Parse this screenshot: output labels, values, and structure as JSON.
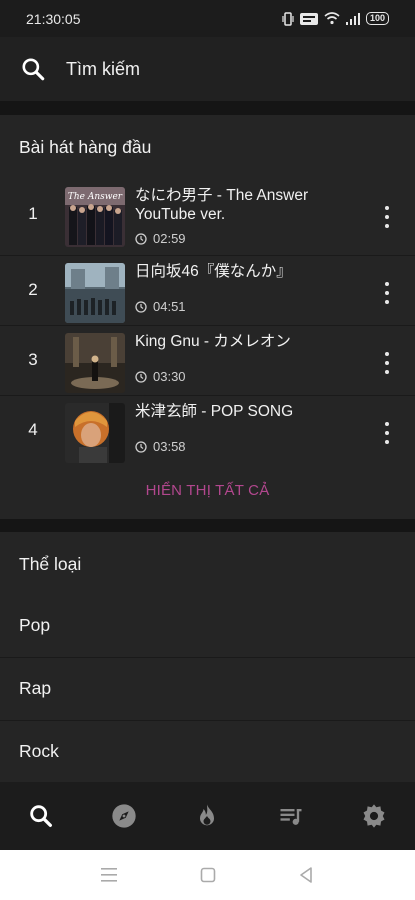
{
  "status_bar": {
    "time": "21:30:05",
    "battery": "100"
  },
  "search": {
    "label": "Tìm kiếm",
    "icon": "search-icon"
  },
  "top_songs": {
    "title": "Bài hát hàng đầu",
    "show_all_label": "HIỂN THỊ TẤT CẢ",
    "songs": [
      {
        "rank": "1",
        "title": "なにわ男子 - The Answer YouTube ver.",
        "duration": "02:59"
      },
      {
        "rank": "2",
        "title": "日向坂46『僕なんか』",
        "duration": "04:51"
      },
      {
        "rank": "3",
        "title": "King Gnu - カメレオン",
        "duration": "03:30"
      },
      {
        "rank": "4",
        "title": "米津玄師 - POP SONG",
        "duration": "03:58"
      }
    ]
  },
  "genres": {
    "title": "Thể loại",
    "items": [
      "Pop",
      "Rap",
      "Rock"
    ]
  },
  "bottom_nav": {
    "items": [
      "search-icon",
      "compass-icon",
      "fire-icon",
      "playlist-icon",
      "settings-icon"
    ],
    "active_color": "#ffffff",
    "inactive_color": "#8a8a8a"
  },
  "colors": {
    "accent": "#b2478e",
    "background": "#151515",
    "card": "#252525"
  }
}
